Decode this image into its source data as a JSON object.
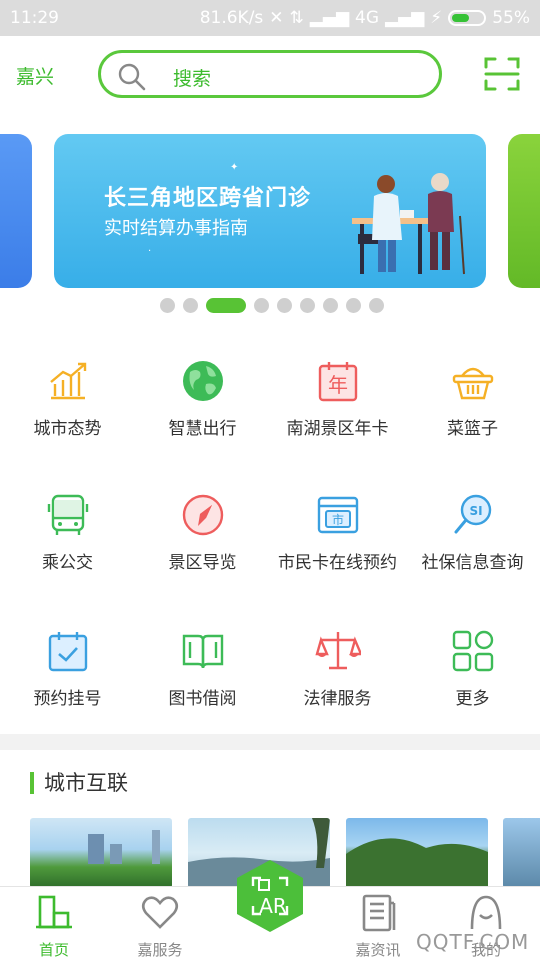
{
  "status_bar": {
    "time": "11:29",
    "speed": "81.6K/s",
    "network": "4G",
    "battery": "55%",
    "battery_level": 0.55
  },
  "header": {
    "city": "嘉兴",
    "search_placeholder": "搜索"
  },
  "banner": {
    "title": "长三角地区跨省门诊",
    "subtitle": "实时结算办事指南",
    "page_count": 9,
    "active_index": 2
  },
  "services": [
    {
      "label": "城市态势",
      "icon": "chart-up-icon",
      "color": "#f5b025"
    },
    {
      "label": "智慧出行",
      "icon": "globe-icon",
      "color": "#3dbb57"
    },
    {
      "label": "南湖景区年卡",
      "icon": "calendar-year-icon",
      "color": "#ee5d5d"
    },
    {
      "label": "菜篮子",
      "icon": "basket-icon",
      "color": "#f5b025"
    },
    {
      "label": "乘公交",
      "icon": "bus-icon",
      "color": "#3dbb57"
    },
    {
      "label": "景区导览",
      "icon": "compass-icon",
      "color": "#ee5d5d"
    },
    {
      "label": "市民卡在线预约",
      "icon": "citizen-card-icon",
      "color": "#3aa0e0"
    },
    {
      "label": "社保信息查询",
      "icon": "social-security-search-icon",
      "color": "#3aa0e0"
    },
    {
      "label": "预约挂号",
      "icon": "calendar-check-icon",
      "color": "#3aa0e0"
    },
    {
      "label": "图书借阅",
      "icon": "book-icon",
      "color": "#3dbb57"
    },
    {
      "label": "法律服务",
      "icon": "scales-icon",
      "color": "#ee5d5d"
    },
    {
      "label": "更多",
      "icon": "more-grid-icon",
      "color": "#3dbb57"
    }
  ],
  "section": {
    "title": "城市互联"
  },
  "tabbar": {
    "items": [
      {
        "label": "首页",
        "icon": "home-building-icon",
        "active": true
      },
      {
        "label": "嘉服务",
        "icon": "heart-icon",
        "active": false
      },
      {
        "label": "嘉资讯",
        "icon": "news-icon",
        "active": false
      },
      {
        "label": "我的",
        "icon": "user-icon",
        "active": false
      }
    ],
    "ar_label": "AR"
  },
  "watermark": "QQTF.COM",
  "colors": {
    "brand": "#58c335",
    "banner": "#37aee8"
  }
}
